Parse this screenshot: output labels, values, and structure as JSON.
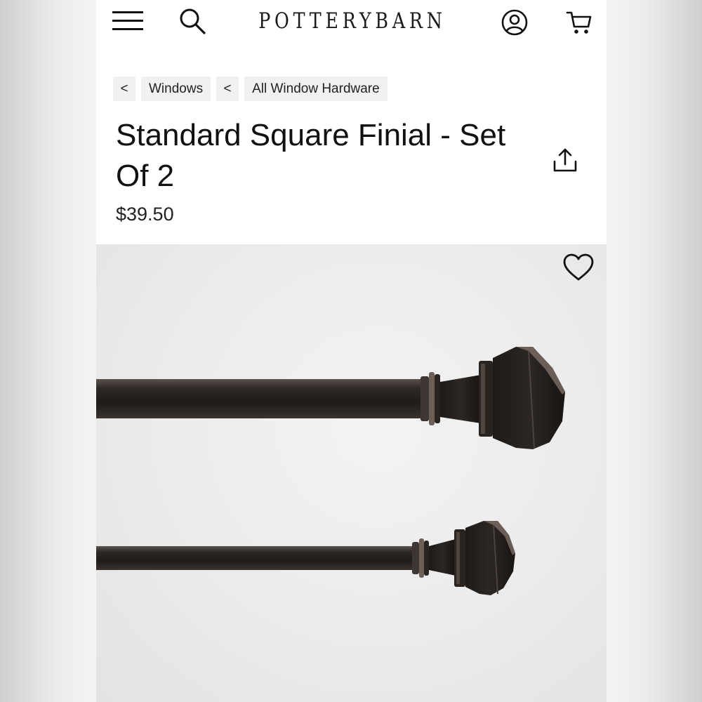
{
  "header": {
    "logo_text": "POTTERYBARN",
    "icons": {
      "menu": "hamburger-menu-icon",
      "search": "search-icon",
      "account": "account-icon",
      "cart": "cart-icon"
    }
  },
  "breadcrumb": [
    {
      "back": "<",
      "label": "Windows"
    },
    {
      "back": "<",
      "label": "All Window Hardware"
    }
  ],
  "product": {
    "title": "Standard Square Finial - Set Of 2",
    "price": "$39.50",
    "share_icon": "share-icon",
    "favorite_icon": "heart-icon"
  },
  "colors": {
    "text": "#111111",
    "breadcrumb_bg": "#f1f1f1",
    "image_bg": "#ebebeb",
    "rod": "#2b2624"
  }
}
